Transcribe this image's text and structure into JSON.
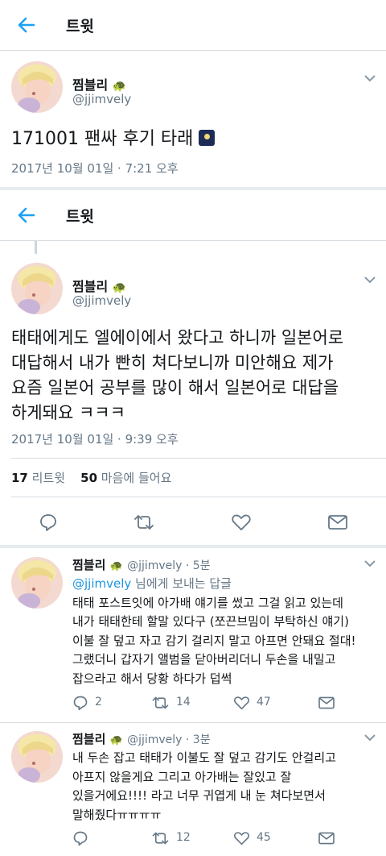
{
  "header1": {
    "title": "트윗"
  },
  "header2": {
    "title": "트윗"
  },
  "tweet1": {
    "name": "찜블리",
    "handle": "@jjimvely",
    "text": "171001 팬싸 후기 타래",
    "date": "2017년 10월 01일 · 7:21 오후"
  },
  "tweet2": {
    "name": "찜블리",
    "handle": "@jjimvely",
    "lines": [
      "태태에게도 엘에이에서 왔다고 하니까 일본어로",
      "대답해서 내가 빤히 쳐다보니까 미안해요 제가",
      "요즘 일본어 공부를 많이 해서 일본어로 대답을",
      "하게돼요 ㅋㅋㅋ"
    ],
    "date": "2017년 10월 01일 · 9:39 오후",
    "retweets_count": "17",
    "retweets_label": "리트윗",
    "likes_count": "50",
    "likes_label": "마음에 들어요"
  },
  "reply1": {
    "name": "찜블리",
    "handle_time": "@jjimvely · 5분",
    "reply_to_handle": "@jjimvely",
    "reply_to_suffix": " 님에게 보내는 답글",
    "lines": [
      "태태 포스트잇에 아가배 얘기를 썼고 그걸 읽고 있는데",
      "내가 태태한테 할말 있다구 (쪼끈브밈이 부탁하신 얘기)",
      "이불 잘 덮고 자고 감기 걸리지 말고 아프면 안돼요 절대!",
      "그랬더니 갑자기 앨범을 닫아버리더니 두손을 내밀고",
      "잡으라고 해서 당황 하다가 덥썩"
    ],
    "reply_count": "2",
    "retweet_count": "14",
    "like_count": "47"
  },
  "reply2": {
    "name": "찜블리",
    "handle_time": "@jjimvely · 3분",
    "lines": [
      "내 두손 잡고 태태가 이불도 잘 덮고 감기도 안걸리고",
      "아프지 않을게요 그리고 아가배는 잘있고 잘",
      "있을거에요!!!! 라고 너무 귀엽게 내 눈 쳐다보면서",
      "말해줬다ㅠㅠㅠㅠ"
    ],
    "retweet_count": "12",
    "like_count": "45"
  },
  "colors": {
    "accent": "#1da1f2",
    "mention": "#1b95e0",
    "muted": "#657786",
    "text": "#14171a",
    "divider": "#d8dde2"
  },
  "icons": [
    "back-arrow-icon",
    "chevron-down-icon",
    "turtle-emoji-icon",
    "night-sky-emoji-icon",
    "reply-icon",
    "retweet-icon",
    "like-icon",
    "message-icon"
  ]
}
